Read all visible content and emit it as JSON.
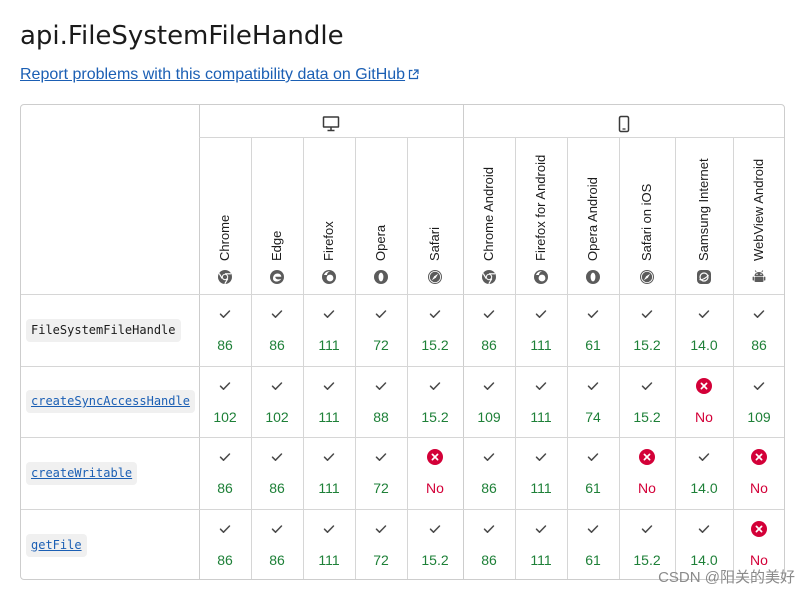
{
  "title": "api.FileSystemFileHandle",
  "report_link": "Report problems with this compatibility data on GitHub",
  "browsers": [
    {
      "name": "Chrome",
      "icon": "chrome-icon",
      "group": "desktop"
    },
    {
      "name": "Edge",
      "icon": "edge-icon",
      "group": "desktop"
    },
    {
      "name": "Firefox",
      "icon": "firefox-icon",
      "group": "desktop"
    },
    {
      "name": "Opera",
      "icon": "opera-icon",
      "group": "desktop"
    },
    {
      "name": "Safari",
      "icon": "safari-icon",
      "group": "desktop"
    },
    {
      "name": "Chrome Android",
      "icon": "chrome-icon",
      "group": "mobile"
    },
    {
      "name": "Firefox for Android",
      "icon": "firefox-icon",
      "group": "mobile"
    },
    {
      "name": "Opera Android",
      "icon": "opera-icon",
      "group": "mobile"
    },
    {
      "name": "Safari on iOS",
      "icon": "safari-icon",
      "group": "mobile"
    },
    {
      "name": "Samsung Internet",
      "icon": "samsung-internet-icon",
      "group": "mobile"
    },
    {
      "name": "WebView Android",
      "icon": "android-icon",
      "group": "mobile"
    }
  ],
  "device_groups": [
    {
      "id": "desktop",
      "icon": "desktop-icon"
    },
    {
      "id": "mobile",
      "icon": "mobile-icon"
    }
  ],
  "rows": [
    {
      "feature": "FileSystemFileHandle",
      "link": false,
      "support": [
        "86",
        "86",
        "111",
        "72",
        "15.2",
        "86",
        "111",
        "61",
        "15.2",
        "14.0",
        "86"
      ]
    },
    {
      "feature": "createSyncAccessHandle",
      "link": true,
      "support": [
        "102",
        "102",
        "111",
        "88",
        "15.2",
        "109",
        "111",
        "74",
        "15.2",
        "No",
        "109"
      ]
    },
    {
      "feature": "createWritable",
      "link": true,
      "support": [
        "86",
        "86",
        "111",
        "72",
        "No",
        "86",
        "111",
        "61",
        "No",
        "14.0",
        "No"
      ]
    },
    {
      "feature": "getFile",
      "link": true,
      "support": [
        "86",
        "86",
        "111",
        "72",
        "15.2",
        "86",
        "111",
        "61",
        "15.2",
        "14.0",
        "No"
      ]
    }
  ],
  "colors": {
    "yes": "#1e8038",
    "no": "#d30038",
    "link": "#1b5fb4",
    "border": "#cdcdcd"
  },
  "watermark": "CSDN @阳关的美好"
}
